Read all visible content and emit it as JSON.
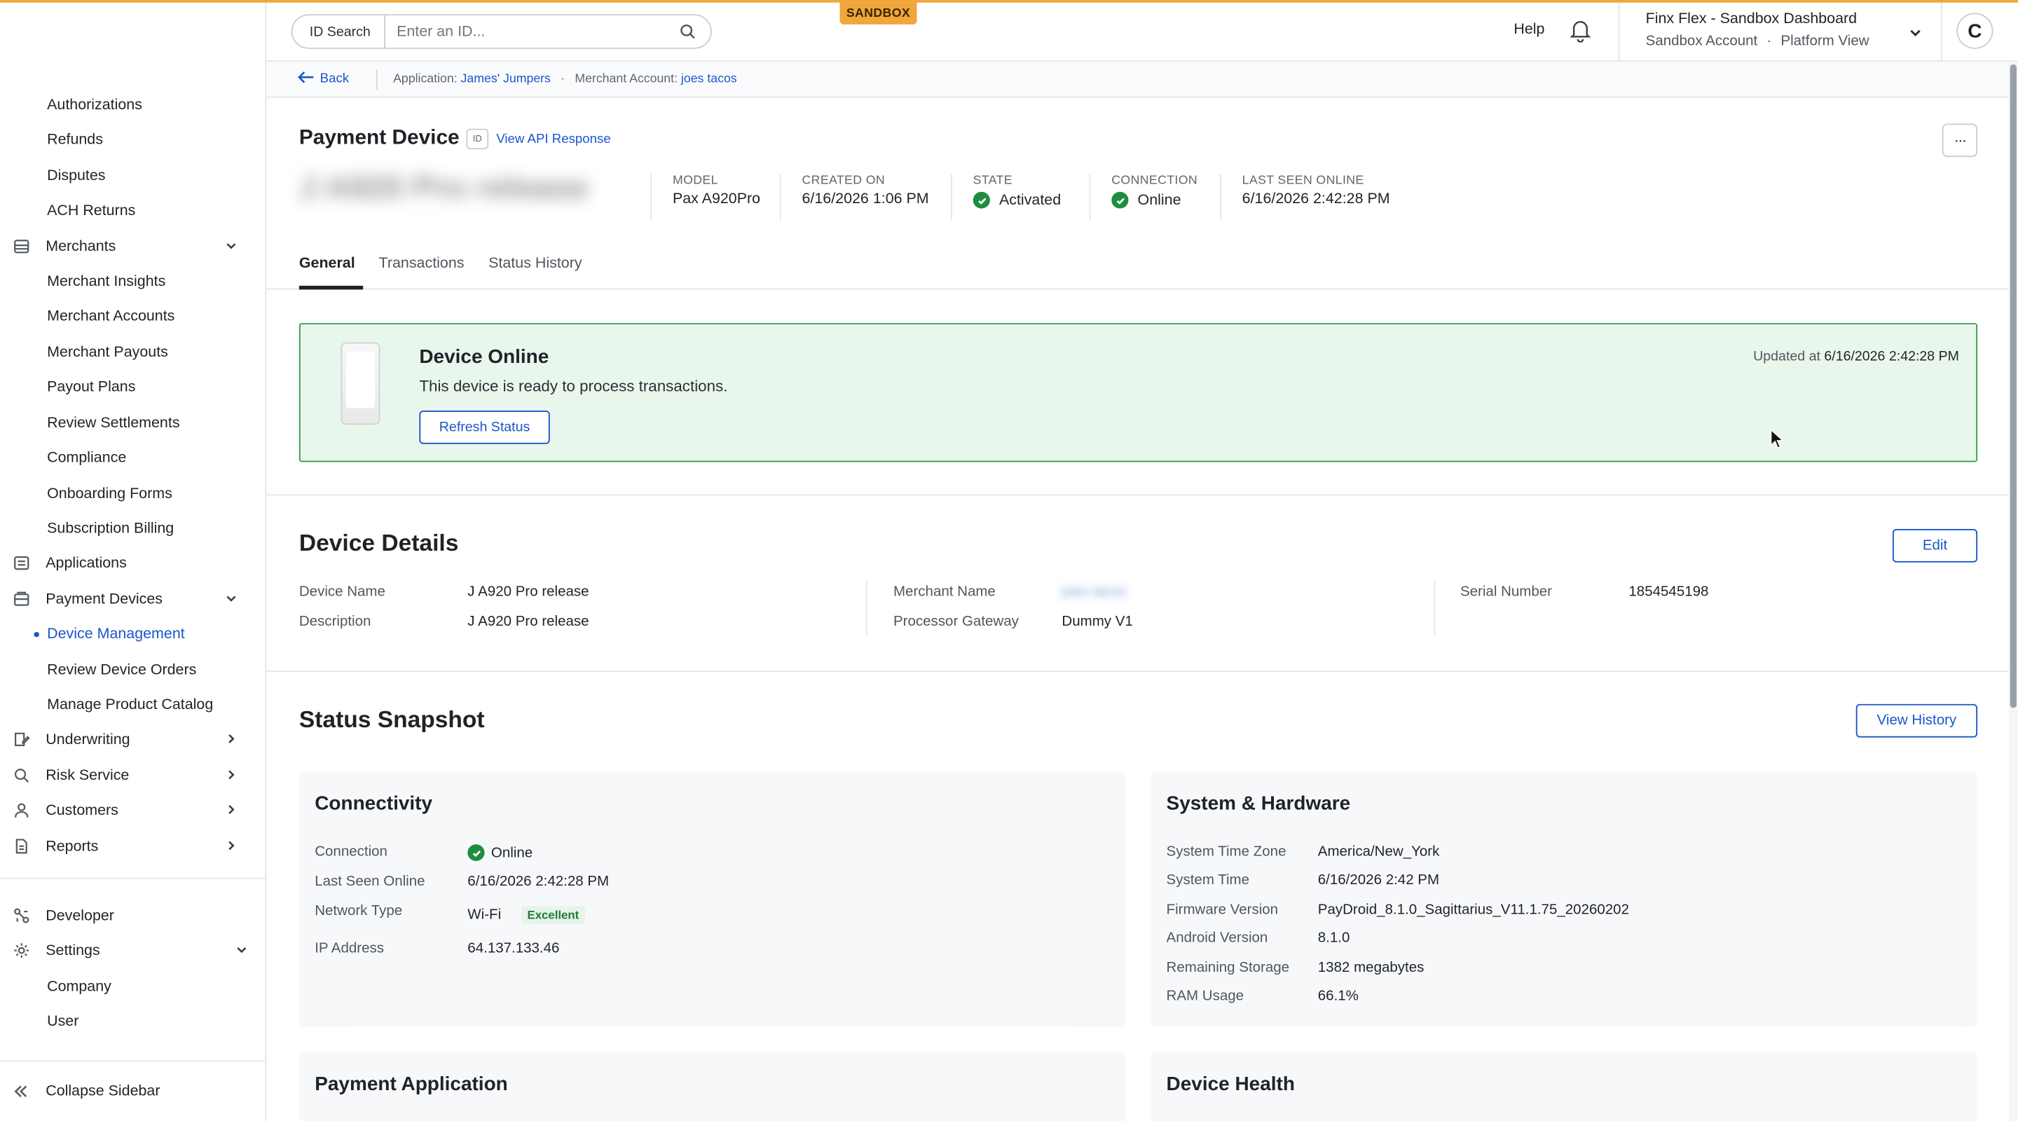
{
  "sidebar": {
    "items_top": [
      "Authorizations",
      "Refunds",
      "Disputes",
      "ACH Returns"
    ],
    "merchants": "Merchants",
    "merchants_items": [
      "Merchant Insights",
      "Merchant Accounts",
      "Merchant Payouts",
      "Payout Plans",
      "Review Settlements",
      "Compliance",
      "Onboarding Forms",
      "Subscription Billing"
    ],
    "applications": "Applications",
    "payment_devices": "Payment Devices",
    "devices_items": [
      "Device Management",
      "Review Device Orders",
      "Manage Product Catalog"
    ],
    "underwriting": "Underwriting",
    "risk_service": "Risk Service",
    "customers": "Customers",
    "reports": "Reports",
    "developer": "Developer",
    "settings": "Settings",
    "settings_items": [
      "Company",
      "User"
    ],
    "collapse": "Collapse Sidebar"
  },
  "topbar": {
    "id_search_label": "ID Search",
    "id_search_placeholder": "Enter an ID...",
    "sandbox": "SANDBOX",
    "help": "Help",
    "account_title": "Finx Flex - Sandbox Dashboard",
    "account_sub_1": "Sandbox Account",
    "account_sub_sep": "·",
    "account_sub_2": "Platform View",
    "avatar": "C",
    "accent_color": "#f0a63a"
  },
  "breadcrumb": {
    "back": "Back",
    "application_label": "Application:",
    "application_value": "James' Jumpers",
    "sep": "·",
    "merchant_label": "Merchant Account:",
    "merchant_value": "joes tacos"
  },
  "device": {
    "title": "Payment Device",
    "id_badge": "ID",
    "api_link": "View API Response",
    "more": "···",
    "name_display": "J A920 Pro release",
    "meta": [
      {
        "label": "MODEL",
        "value": "Pax A920Pro"
      },
      {
        "label": "CREATED ON",
        "value": "6/16/2026 1:06 PM"
      },
      {
        "label": "STATE",
        "value": "Activated"
      },
      {
        "label": "CONNECTION",
        "value": "Online"
      },
      {
        "label": "LAST SEEN ONLINE",
        "value": "6/16/2026 2:42:28 PM"
      }
    ]
  },
  "tabs": [
    "General",
    "Transactions",
    "Status History"
  ],
  "online_card": {
    "title": "Device Online",
    "subtitle": "This device is ready to process transactions.",
    "refresh": "Refresh Status",
    "updated_label": "Updated at",
    "updated_value": "6/16/2026 2:42:28 PM",
    "status_color": "#2fa14e"
  },
  "device_details": {
    "title": "Device Details",
    "edit": "Edit",
    "rows": {
      "device_name_label": "Device Name",
      "device_name_value": "J A920 Pro release",
      "description_label": "Description",
      "description_value": "J A920 Pro release",
      "merchant_name_label": "Merchant Name",
      "merchant_name_value": "joes tacos",
      "processor_gateway_label": "Processor Gateway",
      "processor_gateway_value": "Dummy V1",
      "serial_number_label": "Serial Number",
      "serial_number_value": "1854545198"
    }
  },
  "status_snapshot": {
    "title": "Status Snapshot",
    "view_history": "View History",
    "connectivity": {
      "title": "Connectivity",
      "rows": [
        {
          "label": "Connection",
          "value": "Online"
        },
        {
          "label": "Last Seen Online",
          "value": "6/16/2026 2:42:28 PM"
        },
        {
          "label": "Network Type",
          "value": "Wi-Fi",
          "chip": "Excellent"
        },
        {
          "label": "IP Address",
          "value": "64.137.133.46"
        }
      ]
    },
    "system": {
      "title": "System & Hardware",
      "rows": [
        {
          "label": "System Time Zone",
          "value": "America/New_York"
        },
        {
          "label": "System Time",
          "value": "6/16/2026 2:42 PM"
        },
        {
          "label": "Firmware Version",
          "value": "PayDroid_8.1.0_Sagittarius_V11.1.75_20260202"
        },
        {
          "label": "Android Version",
          "value": "8.1.0"
        },
        {
          "label": "Remaining Storage",
          "value": "1382 megabytes"
        },
        {
          "label": "RAM Usage",
          "value": "66.1%"
        }
      ]
    },
    "payment_application": {
      "title": "Payment Application"
    },
    "device_health": {
      "title": "Device Health"
    }
  },
  "colors": {
    "link": "#1a56c9",
    "success": "#1e8e3e"
  }
}
